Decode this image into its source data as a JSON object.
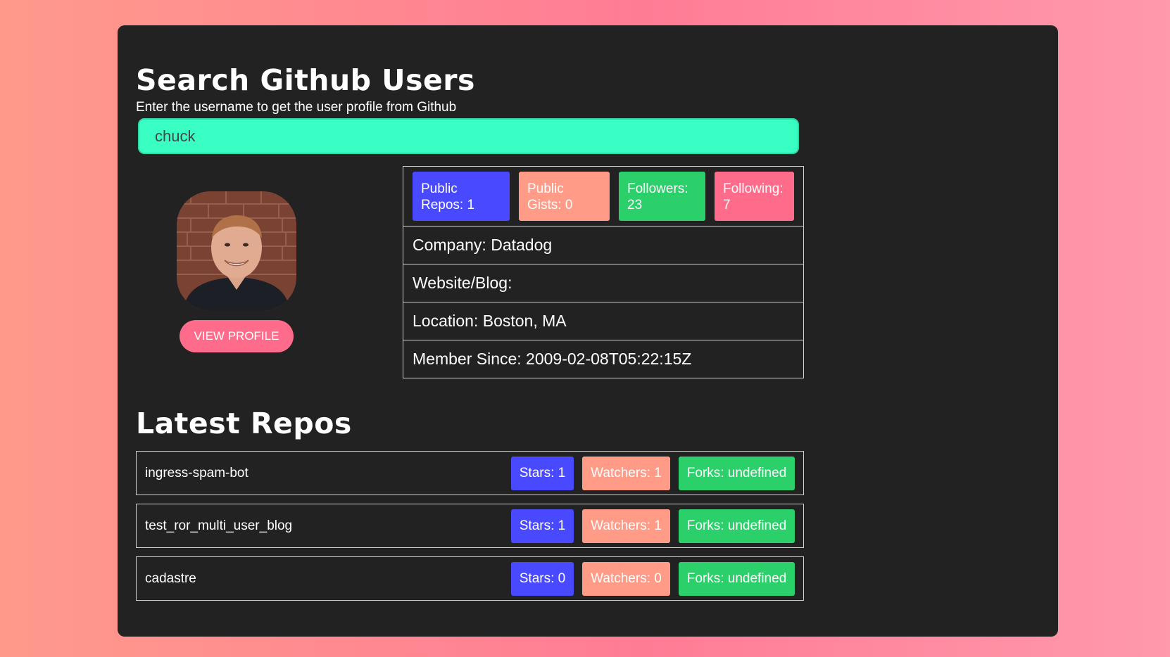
{
  "header": {
    "title": "Search Github Users",
    "subtitle": "Enter the username to get the user profile from Github"
  },
  "search": {
    "value": "chuck"
  },
  "profile": {
    "view_profile_label": "VIEW PROFILE",
    "badges": {
      "public_repos": "Public Repos: 1",
      "public_gists": "Public Gists: 0",
      "followers": "Followers: 23",
      "following": "Following: 7"
    },
    "company": "Company: Datadog",
    "website": "Website/Blog:",
    "location": "Location: Boston, MA",
    "member_since": "Member Since: 2009-02-08T05:22:15Z"
  },
  "repos_section": {
    "title": "Latest Repos",
    "items": [
      {
        "name": "ingress-spam-bot",
        "stars": "Stars: 1",
        "watchers": "Watchers: 1",
        "forks": "Forks: undefined"
      },
      {
        "name": "test_ror_multi_user_blog",
        "stars": "Stars: 1",
        "watchers": "Watchers: 1",
        "forks": "Forks: undefined"
      },
      {
        "name": "cadastre",
        "stars": "Stars: 0",
        "watchers": "Watchers: 0",
        "forks": "Forks: undefined"
      }
    ]
  },
  "colors": {
    "background_gradient_start": "#ff9a8b",
    "background_gradient_end": "#ff99ac",
    "panel": "#222222",
    "search_field": "#3affc4",
    "blue_badge": "#4949ff",
    "salmon_badge": "#ff9b87",
    "green_badge": "#2bd06a",
    "pink_badge": "#ff6b8a"
  }
}
